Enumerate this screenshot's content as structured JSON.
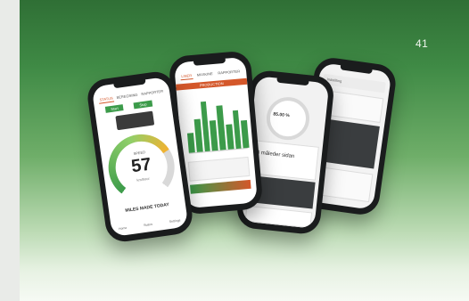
{
  "page_number": "41",
  "phone1": {
    "tabs": [
      "STATUS",
      "BEREGNING",
      "RAPPORTER"
    ],
    "btn_a": "Start",
    "btn_b": "Stop",
    "speed_label": "SPEED",
    "speed_value": "57",
    "speed_unit": "km/hour",
    "footer_title": "MILES MADE TODAY",
    "nav": [
      "Home",
      "Status",
      "Settings"
    ]
  },
  "phone2": {
    "tabs": [
      "LINER",
      "MASKINE",
      "RAPPORTER"
    ],
    "section": "PRODUCTION",
    "bar_values": [
      0.35,
      0.6,
      0.9,
      0.55,
      0.8,
      0.45,
      0.7,
      0.5
    ],
    "colors": {
      "bar": "#3c9b4a",
      "accent": "#d4572a"
    }
  },
  "phone3": {
    "gauge_value": "85.00 %",
    "headline": "8 måleder sidan"
  },
  "phone4": {
    "title": "Indstilling"
  }
}
